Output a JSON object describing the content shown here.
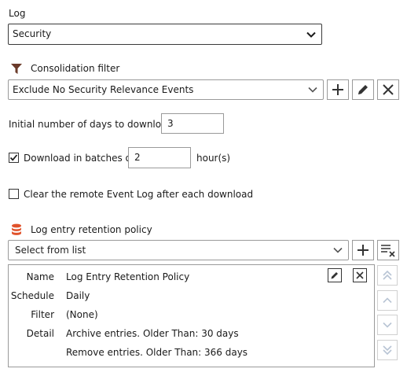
{
  "log": {
    "label": "Log",
    "selected": "Security"
  },
  "consolidation": {
    "label": "Consolidation filter",
    "selected": "Exclude No Security Relevance Events",
    "icon": "funnel-icon"
  },
  "initial_days": {
    "label": "Initial number of days to download",
    "value": "3"
  },
  "batches": {
    "checked": true,
    "label": "Download in batches of",
    "value": "2",
    "unit": "hour(s)"
  },
  "clear_remote": {
    "checked": false,
    "label": "Clear the remote Event Log after each download"
  },
  "retention": {
    "label": "Log entry retention policy",
    "icon": "database-icon",
    "placeholder": "Select from list",
    "policy": {
      "name_label": "Name",
      "name_value": "Log Entry Retention Policy",
      "schedule_label": "Schedule",
      "schedule_value": "Daily",
      "filter_label": "Filter",
      "filter_value": "(None)",
      "detail_label": "Detail",
      "detail_values": [
        "Archive entries.  Older Than: 30 days",
        "Remove entries.  Older Than: 366 days"
      ]
    }
  },
  "colors": {
    "funnel": "#6b3b2a",
    "database": "#e0522b",
    "border_dark": "#3a3a3a",
    "border_light": "#9a9a9a",
    "disabled": "#b8c4d4"
  }
}
